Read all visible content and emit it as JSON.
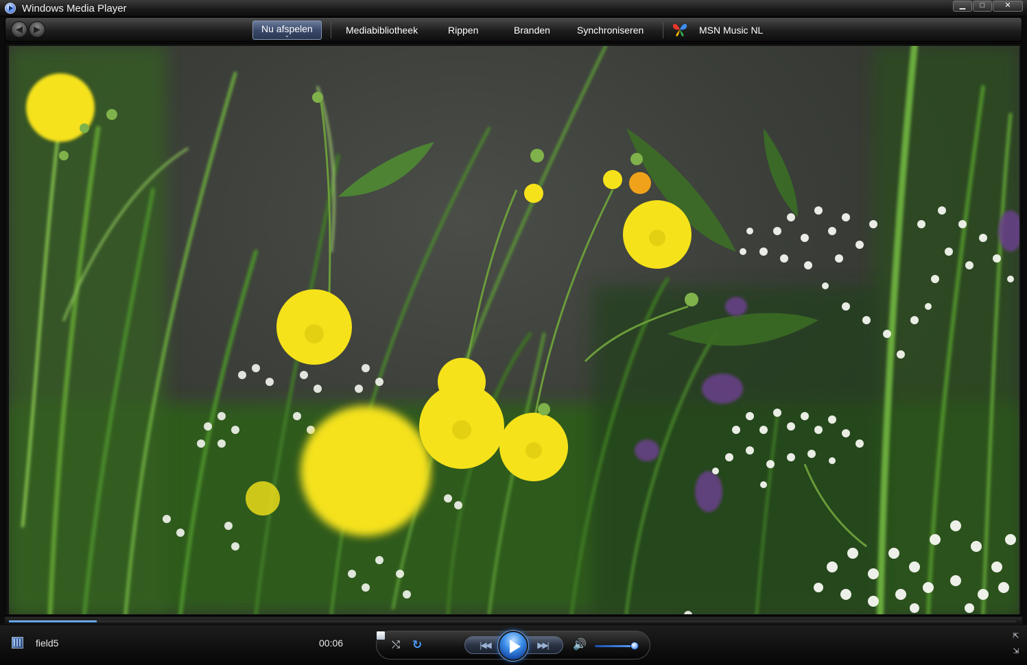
{
  "window": {
    "title": "Windows Media Player",
    "controls": {
      "minimize": "▁",
      "maximize": "□",
      "close": "✕"
    }
  },
  "nav": {
    "back_icon": "back-arrow-icon",
    "forward_icon": "forward-arrow-icon",
    "tabs": [
      {
        "label": "Nu afspelen",
        "active": true
      },
      {
        "label": "Mediabibliotheek"
      },
      {
        "label": "Rippen"
      },
      {
        "label": "Branden"
      },
      {
        "label": "Synchroniseren"
      },
      {
        "label": "MSN Music NL"
      }
    ],
    "active_caret": "⌄"
  },
  "video": {
    "content": "meadow-flowers-video",
    "colors": {
      "grass": "#3f7a25",
      "buttercup": "#f5e21a",
      "background": "#3b3e39"
    }
  },
  "playback": {
    "progress_fraction": 0.087,
    "media_title": "field5",
    "time": "00:06",
    "volume_fraction": 0.9
  },
  "transport": {
    "shuffle_glyph": "⤭",
    "repeat_glyph": "↻",
    "prev_glyph": "|◀◀",
    "next_glyph": "▶▶|",
    "mute_glyph": "🔊"
  },
  "corner": {
    "switch_glyph": "⇱",
    "resize_glyph": "⇲"
  },
  "accent": "#2f7bd6"
}
